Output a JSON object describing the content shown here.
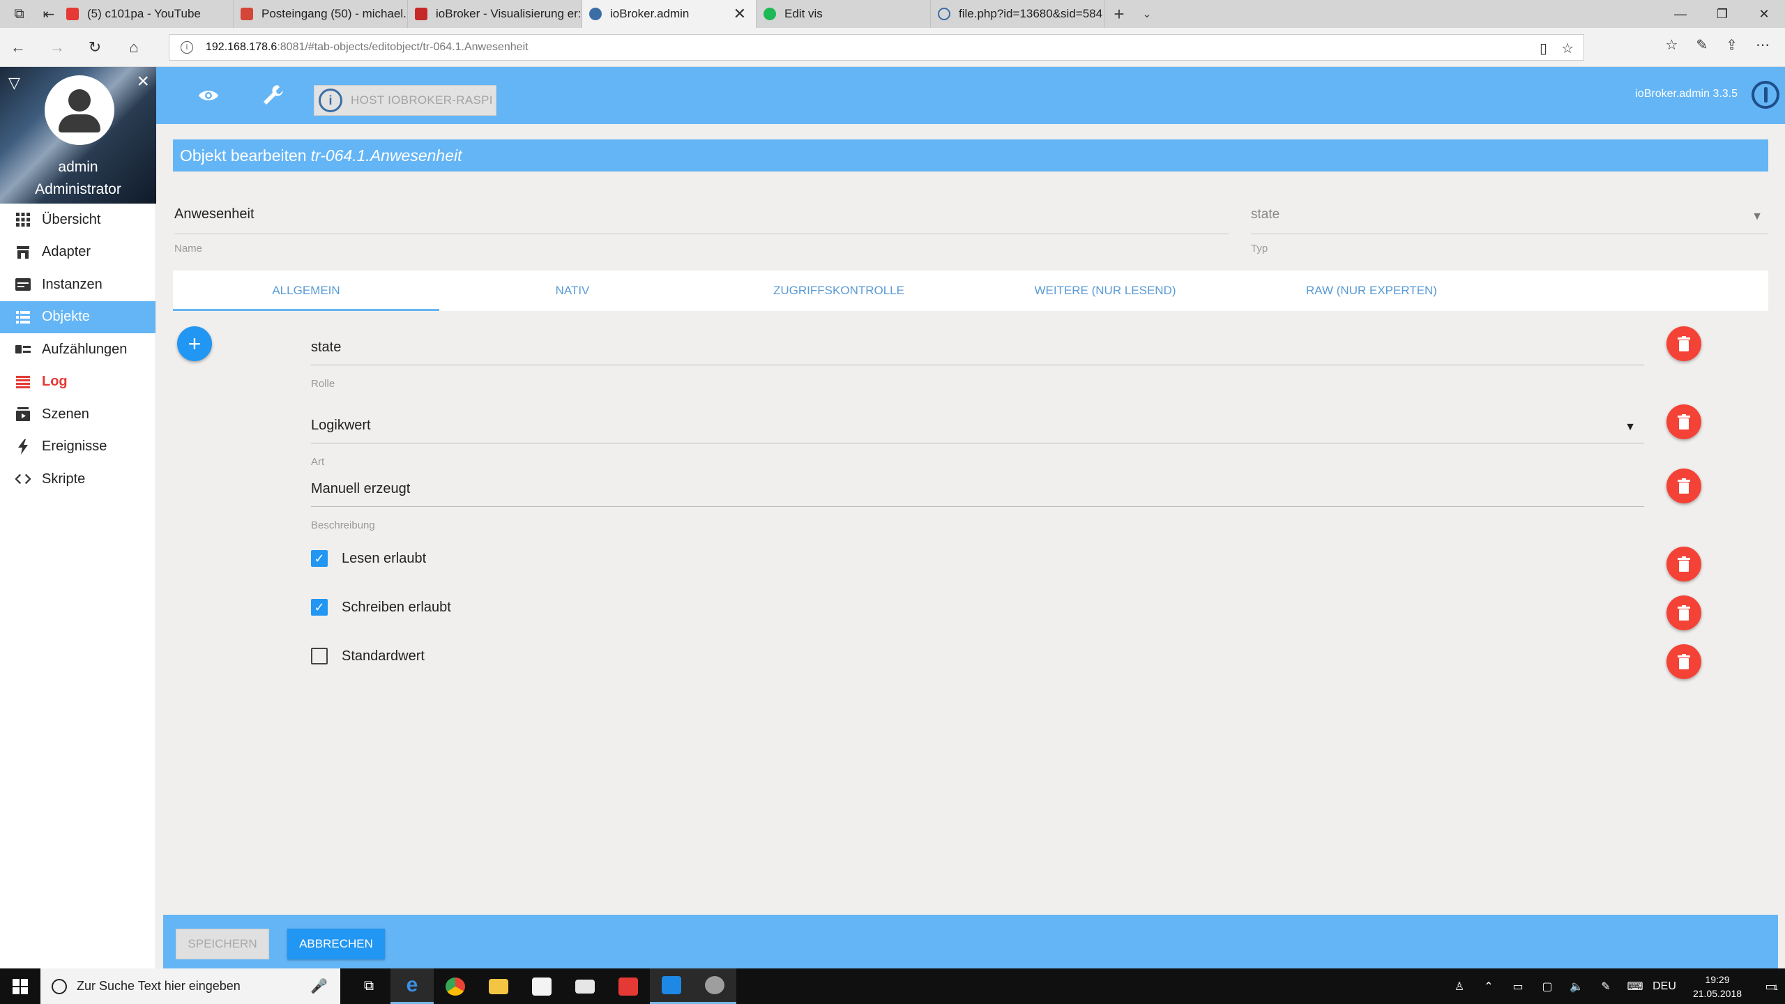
{
  "browser": {
    "tabs": [
      {
        "label": "(5) c101pa - YouTube",
        "color": "#e53935"
      },
      {
        "label": "Posteingang (50) - michael.",
        "color": "#d44638"
      },
      {
        "label": "ioBroker - Visualisierung er:",
        "color": "#c62828"
      },
      {
        "label": "ioBroker.admin",
        "color": "#3b6ea5"
      },
      {
        "label": "Edit vis",
        "color": "#1db954"
      },
      {
        "label": "file.php?id=13680&sid=584",
        "color": "#3b6ea5"
      }
    ],
    "url_host": "192.168.178.6",
    "url_rest": ":8081/#tab-objects/editobject/tr-064.1.Anwesenheit"
  },
  "sidebar": {
    "user_name": "admin",
    "user_role": "Administrator",
    "items": [
      {
        "label": "Übersicht",
        "icon": "grid-icon"
      },
      {
        "label": "Adapter",
        "icon": "store-icon"
      },
      {
        "label": "Instanzen",
        "icon": "instances-icon"
      },
      {
        "label": "Objekte",
        "icon": "list-icon"
      },
      {
        "label": "Aufzählungen",
        "icon": "enum-icon"
      },
      {
        "label": "Log",
        "icon": "log-icon"
      },
      {
        "label": "Szenen",
        "icon": "scenes-icon"
      },
      {
        "label": "Ereignisse",
        "icon": "bolt-icon"
      },
      {
        "label": "Skripte",
        "icon": "code-icon"
      }
    ]
  },
  "appbar": {
    "host_label": "HOST IOBROKER-RASPI",
    "version": "ioBroker.admin 3.3.5"
  },
  "editor": {
    "title_prefix": "Objekt bearbeiten",
    "object_id": "tr-064.1.Anwesenheit",
    "name_value": "Anwesenheit",
    "name_label": "Name",
    "type_value": "state",
    "type_label": "Typ",
    "tabs": [
      "ALLGEMEIN",
      "NATIV",
      "ZUGRIFFSKONTROLLE",
      "WEITERE (NUR LESEND)",
      "RAW (NUR EXPERTEN)"
    ],
    "role_value": "state",
    "role_label": "Rolle",
    "kind_value": "Logikwert",
    "kind_label": "Art",
    "desc_value": "Manuell erzeugt",
    "desc_label": "Beschreibung",
    "read_label": "Lesen erlaubt",
    "read_checked": true,
    "write_label": "Schreiben erlaubt",
    "write_checked": true,
    "default_label": "Standardwert",
    "default_checked": false
  },
  "actions": {
    "save_label": "SPEICHERN",
    "cancel_label": "ABBRECHEN"
  },
  "taskbar": {
    "search_placeholder": "Zur Suche Text hier eingeben",
    "language": "DEU",
    "time": "19:29",
    "date": "21.05.2018",
    "notification_count": "1"
  },
  "colors": {
    "primary": "#64b5f6",
    "accent": "#2196f3",
    "danger": "#f44336",
    "log_red": "#e53935"
  }
}
